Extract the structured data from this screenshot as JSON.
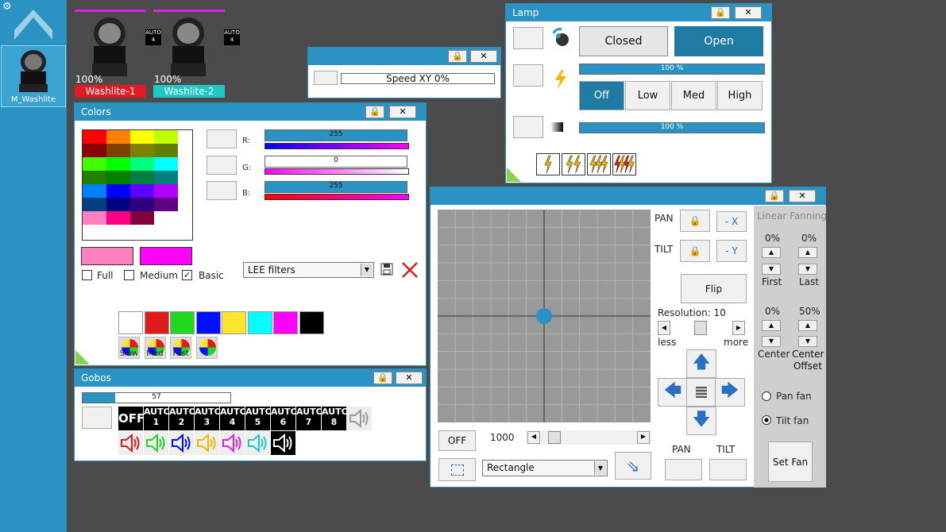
{
  "sidebar": {
    "fixture_label": "M_Washlite"
  },
  "fixtures": [
    {
      "name": "Washlite-1",
      "pct": "100%",
      "auto": "AUTO",
      "auto_num": "4",
      "color": "#e01b24"
    },
    {
      "name": "Washlite-2",
      "pct": "100%",
      "auto": "AUTO",
      "auto_num": "4",
      "color": "#1fc7c7"
    }
  ],
  "speed": {
    "label": "Speed XY     0%",
    "lock": "🔒",
    "close": "✕"
  },
  "colors": {
    "title": "Colors",
    "lock": "🔒",
    "close": "✕",
    "r_label": "R:",
    "g_label": "G:",
    "b_label": "B:",
    "r_value": "255",
    "g_value": "0",
    "b_value": "255",
    "full_label": "Full",
    "medium_label": "Medium",
    "basic_label": "Basic",
    "basic_check": "✓",
    "filter_value": "LEE filters",
    "grid": [
      [
        "#ff0000",
        "#ff7f00",
        "#ffff00",
        "#c0ff00"
      ],
      [
        "#8b0000",
        "#7f3f00",
        "#7f7f00",
        "#607f00"
      ],
      [
        "#40ff00",
        "#00ff00",
        "#00ff80",
        "#00ffff"
      ],
      [
        "#208000",
        "#008000",
        "#008040",
        "#008080"
      ],
      [
        "#0080ff",
        "#0000ff",
        "#6000ff",
        "#b000ff"
      ],
      [
        "#004080",
        "#000080",
        "#300080",
        "#600080"
      ],
      [
        "#ff80c0",
        "#ff0080",
        "#800040",
        "#ffffff"
      ]
    ],
    "preset": [
      "#ffffff",
      "#e01b1b",
      "#1fd81f",
      "#0010ff",
      "#ffe52e",
      "#00ffff",
      "#ff00ff",
      "#000000"
    ],
    "cycle": [
      "Slow",
      "Med",
      "Fast",
      ""
    ]
  },
  "gobos": {
    "title": "Gobos",
    "lock": "🔒",
    "close": "✕",
    "value": "57",
    "items": [
      {
        "a": "OFF",
        "b": ""
      },
      {
        "a": "AUTO",
        "b": "1"
      },
      {
        "a": "AUTO",
        "b": "2"
      },
      {
        "a": "AUTO",
        "b": "3"
      },
      {
        "a": "AUTO",
        "b": "4"
      },
      {
        "a": "AUTO",
        "b": "5"
      },
      {
        "a": "AUTO",
        "b": "6"
      },
      {
        "a": "AUTO",
        "b": "7"
      },
      {
        "a": "AUTO",
        "b": "8"
      }
    ]
  },
  "lamp": {
    "title": "Lamp",
    "lock": "🔒",
    "close": "✕",
    "closed": "Closed",
    "open": "Open",
    "bar1": "100 %",
    "bar2": "100 %",
    "off": "Off",
    "low": "Low",
    "med": "Med",
    "high": "High"
  },
  "position": {
    "lock": "🔒",
    "close": "✕",
    "pan": "PAN",
    "tilt": "TILT",
    "minus_x": "- X",
    "minus_y": "- Y",
    "flip": "Flip",
    "resolution": "Resolution: 10",
    "less": "less",
    "more": "more",
    "pan_bottom": "PAN",
    "tilt_bottom": "TILT",
    "off": "OFF",
    "value": "1000",
    "shape": "Rectangle",
    "dot_x": 0,
    "dot_y": 0
  },
  "fanning": {
    "title": "Linear Fanning",
    "first_pct": "0%",
    "last_pct": "0%",
    "first": "First",
    "last": "Last",
    "center_pct": "0%",
    "offset_pct": "50%",
    "center": "Center",
    "offset": "Center Offset",
    "pan_fan": "Pan fan",
    "tilt_fan": "Tilt fan",
    "set_fan": "Set Fan"
  }
}
